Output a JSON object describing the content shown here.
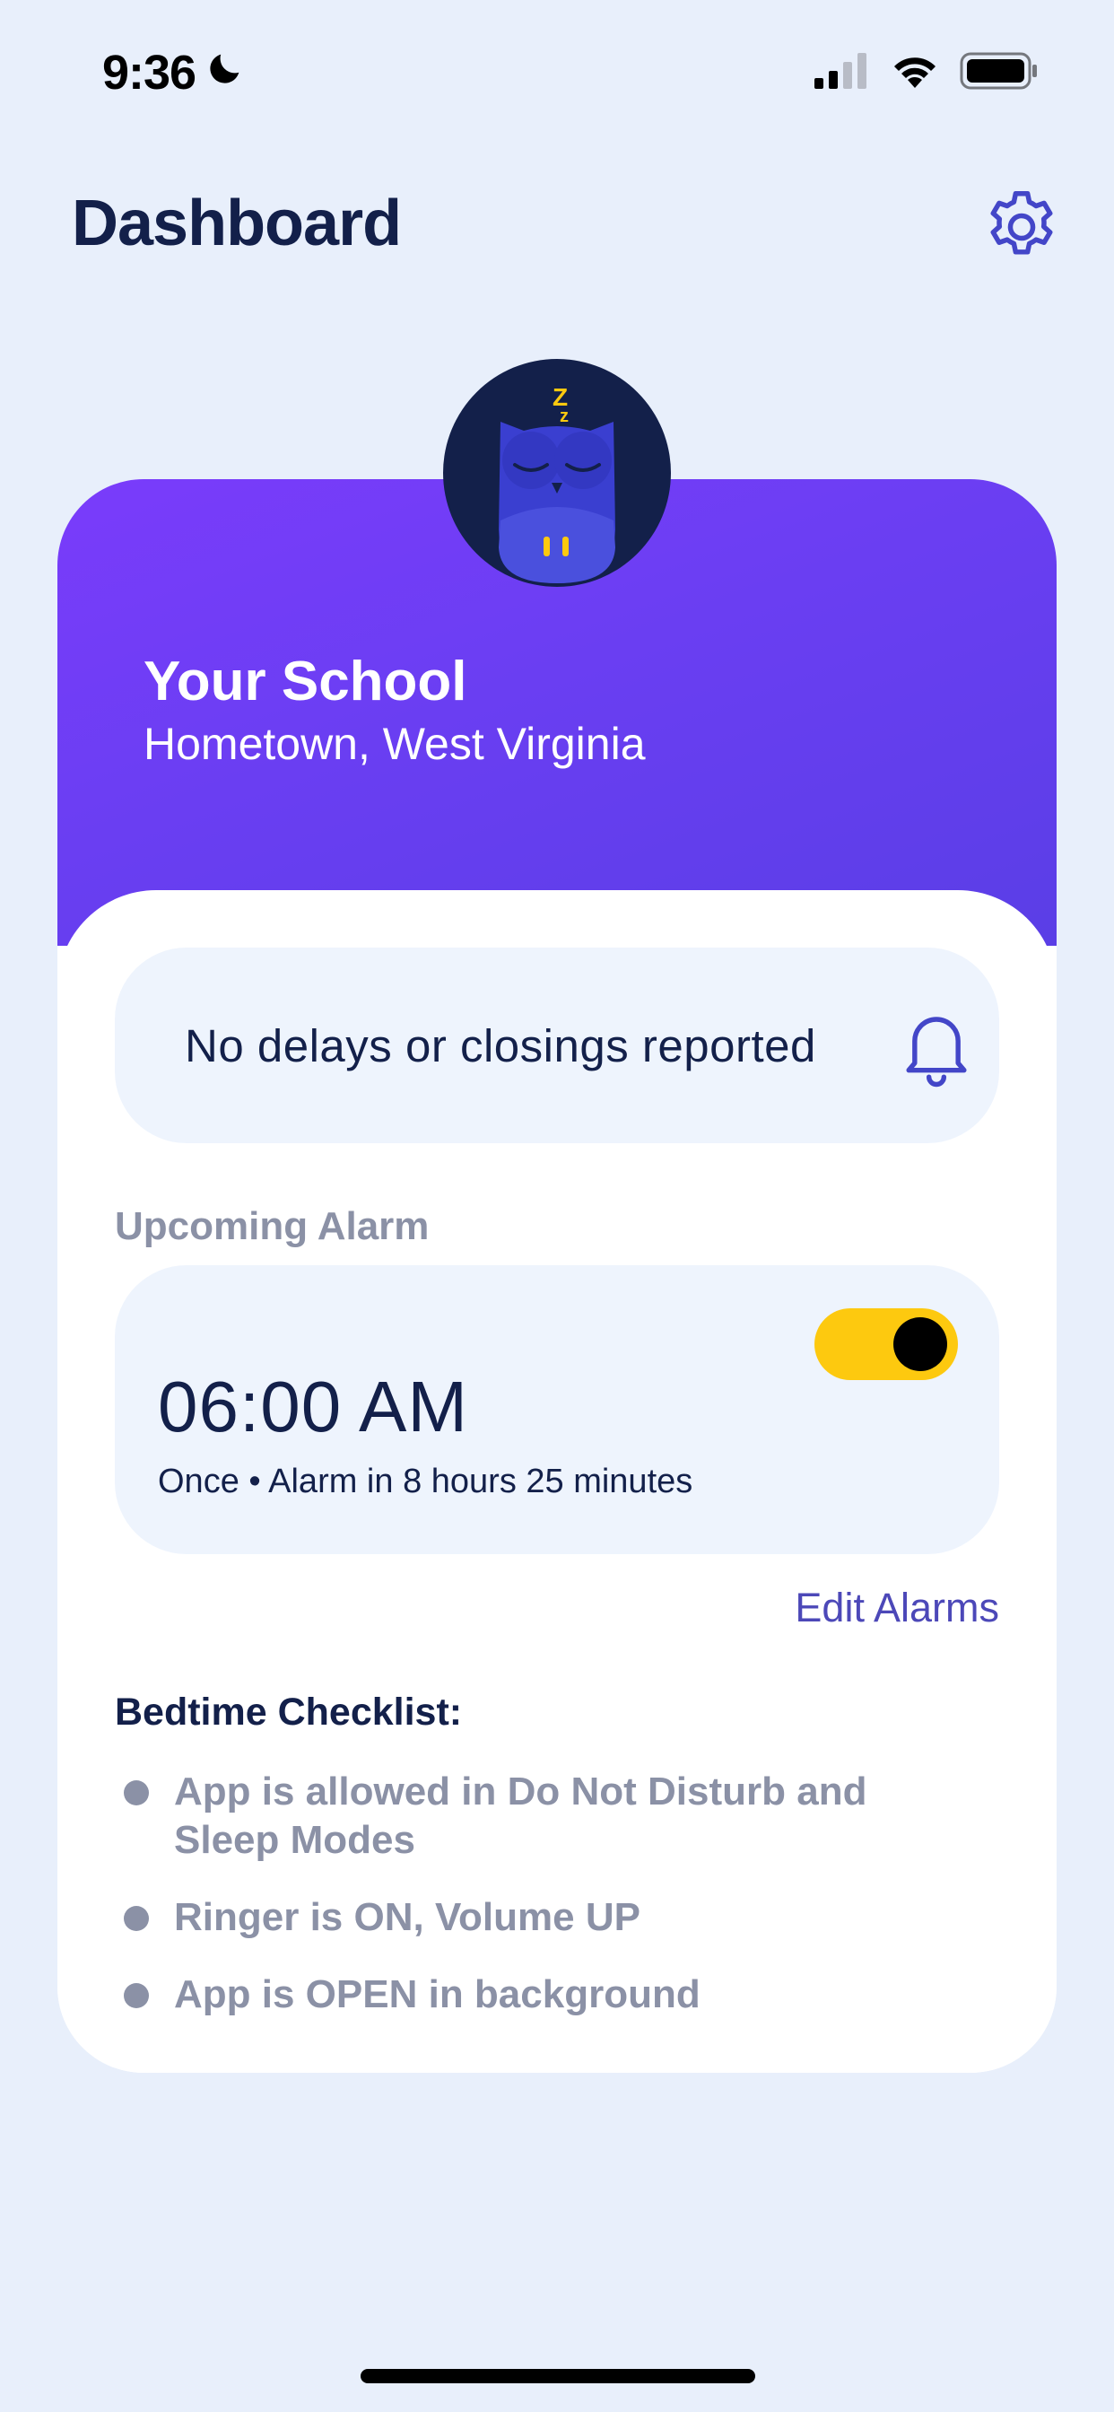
{
  "status_bar": {
    "time": "9:36",
    "icons": [
      "moon-icon",
      "cellular-signal-icon",
      "wifi-icon",
      "battery-icon"
    ]
  },
  "header": {
    "title": "Dashboard",
    "settings_icon": "gear-icon"
  },
  "school": {
    "name": "Your School",
    "location": "Hometown, West Virginia",
    "avatar_icon": "sleeping-owl-icon",
    "avatar_zz": "Z",
    "avatar_zz_small": "z"
  },
  "status": {
    "message": "No delays or closings reported",
    "icon": "bell-icon"
  },
  "alarm": {
    "section_label": "Upcoming Alarm",
    "time": "06:00 AM",
    "detail": "Once • Alarm in 8 hours 25 minutes",
    "enabled": true,
    "edit_label": "Edit Alarms"
  },
  "checklist": {
    "title": "Bedtime Checklist:",
    "items": [
      "App is allowed in Do Not Disturb and Sleep Modes",
      "Ringer is ON, Volume UP",
      "App is OPEN in background"
    ]
  },
  "colors": {
    "background": "#e8effb",
    "accent_purple": "#7a3cfb",
    "toggle_on": "#fdc90f",
    "link": "#4c48b8",
    "muted": "#8b91a6",
    "dark_navy": "#13204a"
  }
}
